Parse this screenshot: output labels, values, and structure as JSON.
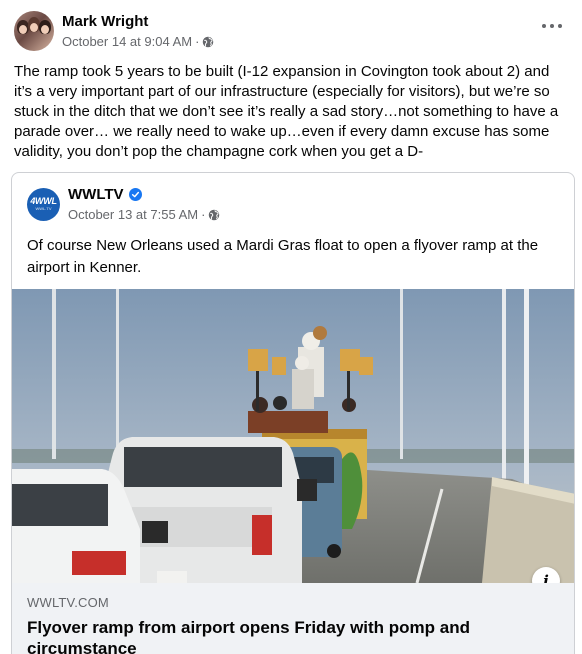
{
  "post": {
    "author": "Mark Wright",
    "timestamp": "October 14 at 9:04 AM",
    "separator": "·",
    "privacy_icon": "globe-icon",
    "more_icon": "more-options-icon",
    "text": "The ramp took 5 years to be built (I-12 expansion in Covington took about 2) and it’s a very important part of our infrastructure (especially for visitors), but we’re so stuck in the ditch that we don’t see it’s really a sad story…not something to have a parade over… we really need to wake up…even if every damn excuse has some validity, you don’t pop the champagne cork when you get a D-"
  },
  "shared": {
    "page_name": "WWLTV",
    "logo_text": "4WWL",
    "logo_subtext": "WWL.TV",
    "verified_icon": "verified-badge-icon",
    "timestamp": "October 13 at 7:55 AM",
    "separator": "·",
    "privacy_icon": "globe-icon",
    "text": "Of course New Orleans used a Mardi Gras float to open a flyover ramp at the airport in Kenner.",
    "info_icon": "info-icon",
    "info_label": "i",
    "link": {
      "domain": "WWLTV.COM",
      "title": "Flyover ramp from airport opens Friday with pomp and circumstance"
    }
  },
  "colors": {
    "text_primary": "#050505",
    "text_secondary": "#65676b",
    "verified": "#1877f2",
    "link_footer_bg": "#f0f2f5",
    "border": "#ced0d4"
  }
}
